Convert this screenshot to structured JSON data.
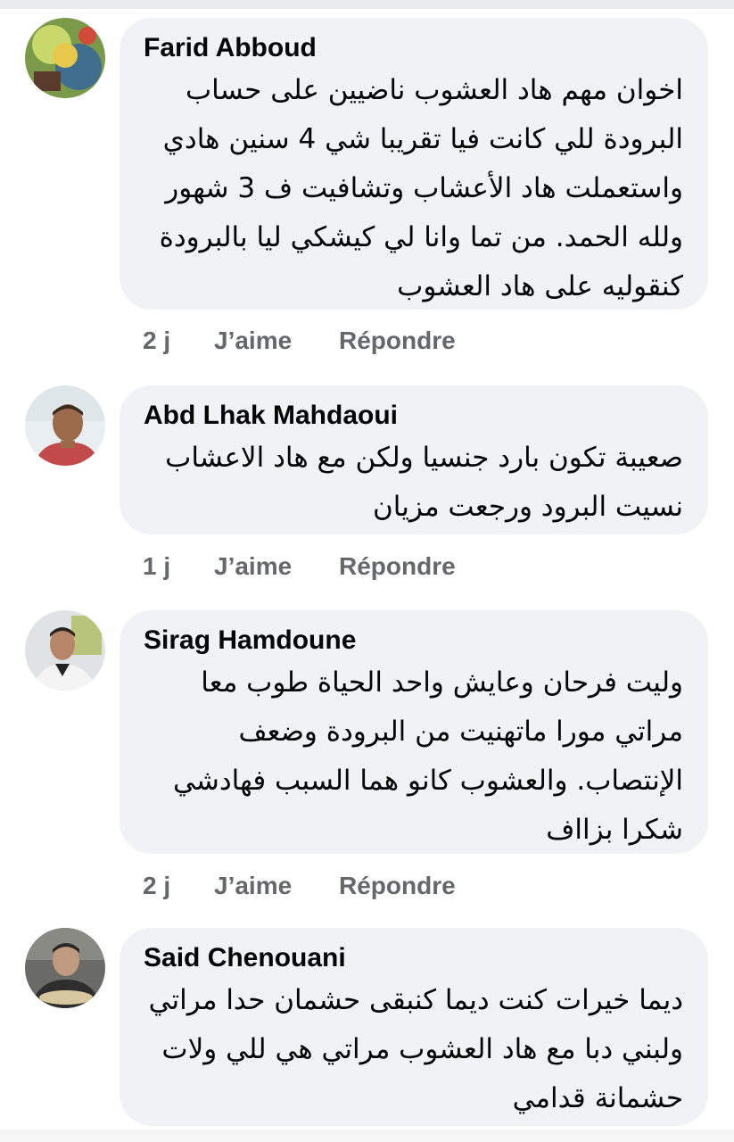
{
  "comments": [
    {
      "author": "Farid Abboud",
      "lines": [
        "اخوان مهم هاد العشوب ناضيين على حساب",
        "البرودة للي كانت فيا تقريبا شي 4 سنين هادي",
        "واستعملت هاد الأعشاب وتشافيت ف 3 شهور",
        "ولله الحمد. من تما وانا لي كيشكي ليا بالبرودة",
        "كنقوليه على هاد العشوب"
      ],
      "time": "2 j",
      "like": "J’aime",
      "reply": "Répondre"
    },
    {
      "author": "Abd Lhak Mahdaoui",
      "lines": [
        "صعيبة تكون بارد جنسيا ولكن مع هاد الاعشاب",
        "نسيت البرود ورجعت مزيان"
      ],
      "time": "1 j",
      "like": "J’aime",
      "reply": "Répondre"
    },
    {
      "author": "Sirag Hamdoune",
      "lines": [
        "وليت فرحان وعايش واحد الحياة طوب معا",
        "مراتي مورا ماتهنيت من البرودة وضعف",
        "الإنتصاب. والعشوب كانو هما السبب فهادشي",
        "شكرا بزااف"
      ],
      "time": "2 j",
      "like": "J’aime",
      "reply": "Répondre"
    },
    {
      "author": "Said Chenouani",
      "lines": [
        "ديما خيرات كنت ديما كنبقى حشمان حدا مراتي",
        "ولبني دبا مع هاد العشوب مراتي هي للي ولات",
        "حشمانة قدامي"
      ]
    }
  ]
}
